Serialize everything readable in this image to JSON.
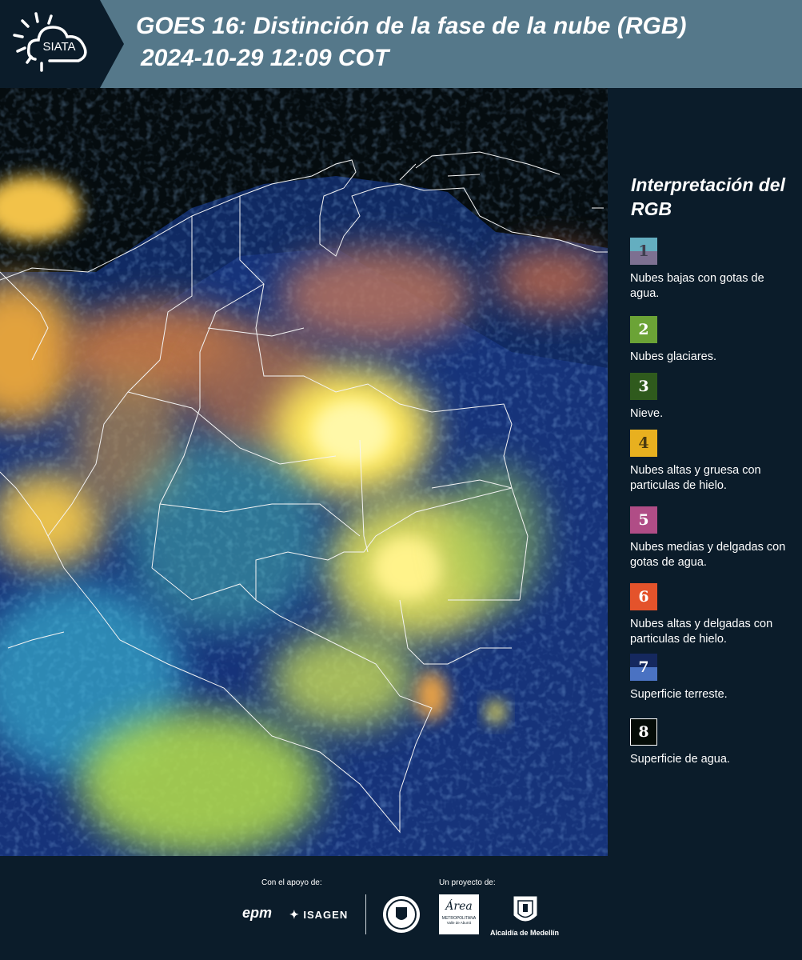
{
  "header": {
    "logo_text": "SIATA",
    "title_line1": "GOES 16: Distinción de la fase de la nube (RGB)",
    "title_line2": "2024-10-29 12:09 COT",
    "bg_color": "#55788a"
  },
  "legend": {
    "title": "Interpretación del RGB",
    "items": [
      {
        "num": "1",
        "label": "Nubes bajas con gotas de agua.",
        "color_top": "#64aec0",
        "color_bottom": "#7d7091",
        "text_color": "#3f3f4f"
      },
      {
        "num": "2",
        "label": "Nubes glaciares.",
        "color": "#6ba336",
        "text_color": "#ffffff"
      },
      {
        "num": "3",
        "label": "Nieve.",
        "color": "#2f5a1d",
        "text_color": "#ffffff"
      },
      {
        "num": "4",
        "label": "Nubes altas y gruesa con particulas de hielo.",
        "color": "#e8b01f",
        "text_color": "#4a3a10"
      },
      {
        "num": "5",
        "label": "Nubes medias y delgadas con gotas de agua.",
        "color": "#b04d86",
        "text_color": "#ffffff"
      },
      {
        "num": "6",
        "label": "Nubes altas y delgadas con particulas de hielo.",
        "color": "#e4532b",
        "text_color": "#ffffff"
      },
      {
        "num": "7",
        "label": "Superficie terreste.",
        "color_top": "#15285e",
        "color_bottom": "#4a72c2",
        "text_color": "#ffffff"
      },
      {
        "num": "8",
        "label": "Superficie de agua.",
        "color": "#050c08",
        "text_color": "#ffffff",
        "border": "#ffffff"
      }
    ]
  },
  "footer": {
    "support_label": "Con el apoyo de:",
    "project_label": "Un proyecto de:",
    "sponsor1": "epm",
    "sponsor2": "ISAGEN",
    "partner1": "Área",
    "partner1_sub": "METROPOLITANA",
    "partner1_sub2": "Valle de Aburrá",
    "partner2": "Alcaldía de Medellín"
  }
}
